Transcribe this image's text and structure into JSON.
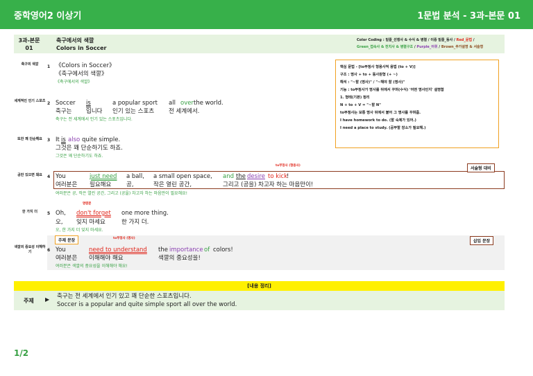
{
  "header": {
    "title": "중학영어2 이상기",
    "section": "1문법 분석 - 3과-본문 01"
  },
  "lesson": {
    "num1": "3과-본문",
    "num2": "01",
    "title_ko": "축구에서의 색깔",
    "title_en": "Colors in Soccer",
    "cc1": "Color Coding : 밑줄_선행사 & 수식 & 병렬 / 이중 밑줄_동사 / ",
    "cc_red": "Red_문법",
    "cc_slash": " / ",
    "cc_green": "Green_접속사 & 전치사 & 병렬구조",
    "cc_sep": " / ",
    "cc_purple": "Purple_어휘",
    "cc_sep2": " / ",
    "cc_brown": "Brown_추가설명 & 서술형"
  },
  "grammar": [
    "핵심 문법 - [to부정사 형용사적 용법 (to + V)]",
    "구조 : 명사 + to + 동사원형 (+ ~)",
    "해석 : \"~할 (명사)\" / \"~해야 할 (명사)\"",
    "기능 : to부정사가 명사를 뒤에서 꾸며(수식) '어떤 명사인지' 설명함",
    "1. 형태(기본) 정리",
    "N + to + V = \"~할 N\"",
    "to부정사는 보통 명사 뒤에서 붙어 그 명사를 꾸며줌.",
    "I have homework to do. (할 숙제가 있어.)",
    "I need a place to study. (공부할 장소가 필요해.)"
  ],
  "rows": {
    "r1": {
      "label": "축구의 색깔",
      "num": "1",
      "en": "《Colors in Soccer》",
      "ko": "《축구에서의 색깔》",
      "tr": "《축구에서의 색깔》"
    },
    "r2": {
      "label": "세계적인 인기 스포츠",
      "num": "2",
      "en": [
        "Soccer",
        "is",
        "a popular sport",
        "all",
        "over",
        "the world."
      ],
      "ko": [
        "축구는",
        "입니다",
        "인기 있는 스포츠",
        "전 세계에서."
      ],
      "tr": "축구는 전 세계에서 인기 있는 스포츠입니다."
    },
    "r3": {
      "label": "또한 꽤 단순해요",
      "num": "3",
      "en": [
        "It",
        "is",
        "also",
        "quite simple."
      ],
      "ko": "그것은 꽤 단순하기도 하죠.",
      "tr": "그것은 꽤 단순하기도 하죠."
    },
    "r4": {
      "label": "공만 있으면 돼요",
      "num": "4",
      "en": [
        "You",
        "just need",
        "a ball,",
        "a small open space,",
        "and",
        "the",
        "desire",
        "to kick",
        "!"
      ],
      "ko": [
        "여러분은",
        "필요해요",
        "공,",
        "작은 열린 공간,",
        "그리고 (공을) 차고자 하는 마음만이!"
      ],
      "tr": "여러분은 공, 작은 열린 공간, 그리고 (공을) 차고자 하는 마음만이 필요해요!",
      "ann": "to부정사 (형용사)",
      "tag": "서술형 대비"
    },
    "r5": {
      "label": "한 가지 더",
      "num": "5",
      "en": [
        "Oh,",
        "don't forget",
        "one more thing."
      ],
      "ko": [
        "오,",
        "잊지 마세요",
        "한 가지 더."
      ],
      "tr": "오, 한 가지 더 잊지 마세요.",
      "ann": "명령문"
    },
    "r6": {
      "label": "색깔의 중요성 이해하기",
      "num": "6",
      "en": [
        "You",
        "need to understand",
        "the",
        "importance",
        "of",
        "colors!"
      ],
      "ko": [
        "여러분은",
        "이해해야 해요",
        "색깔의 중요성을!"
      ],
      "tr": "여러분은 색깔의 중요성을 이해해야 해요!",
      "ann": "to부정사 (명사)",
      "tag_topic": "주제 문장",
      "tag_insert": "삽입 문장"
    }
  },
  "summary": {
    "head": "[내용 정리]",
    "label": "주제",
    "arrow": "▶",
    "ko": "축구는 전 세계에서 인기 있고 꽤 단순한 스포츠입니다.",
    "en": "Soccer is a popular and quite simple sport all over the world."
  },
  "page": "1/2"
}
